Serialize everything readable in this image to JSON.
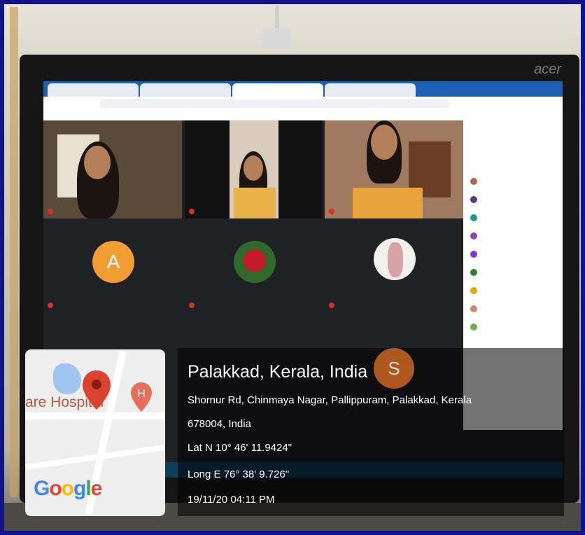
{
  "geotag": {
    "place": "Palakkad, Kerala, India",
    "address_line1": "Shornur Rd, Chinmaya Nagar, Pallippuram, Palakkad, Kerala",
    "address_line2": "678004, India",
    "latitude": "Lat N 10° 46' 11.9424\"",
    "longitude": "Long E 76° 38' 9.726\"",
    "timestamp": "19/11/20 04:11 PM"
  },
  "map": {
    "label": "are Hospital",
    "logo": "Google",
    "logo_colors": [
      "#4285F4",
      "#EA4335",
      "#FBBC05",
      "#4285F4",
      "#34A853",
      "#EA4335"
    ],
    "pin_color": "#d9432f",
    "hospital_pin_color": "#e76f5a"
  },
  "monitor": {
    "brand": "acer"
  },
  "meet": {
    "avatar_letter_1": "A",
    "avatar_letter_2": "S",
    "avatar_1_color": "#f29d32",
    "avatar_2_color": "#c9651f"
  },
  "colors": {
    "border": "#12128a"
  }
}
